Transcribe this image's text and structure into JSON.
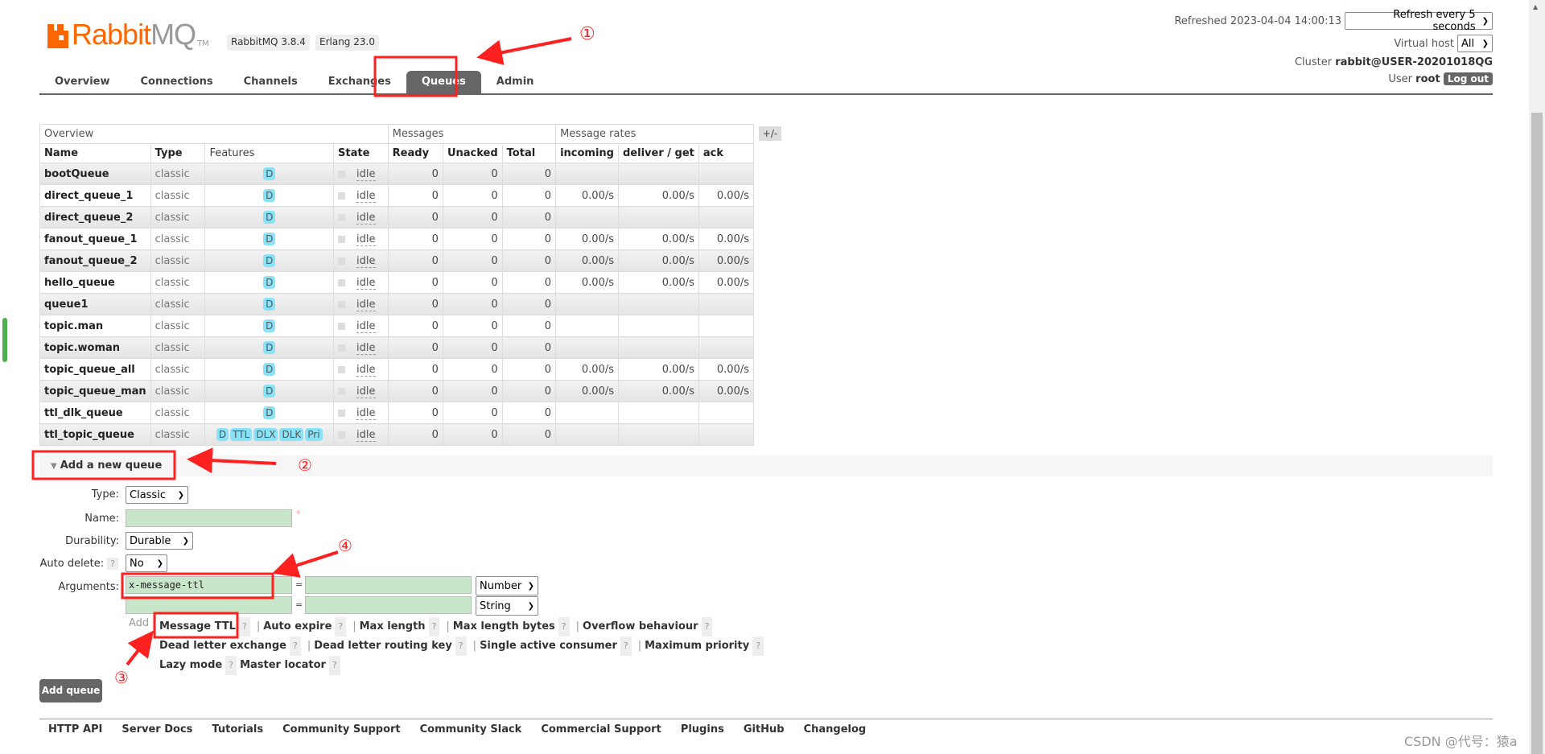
{
  "header": {
    "logo": "RabbitMQ",
    "logo_tm": "TM",
    "version": "RabbitMQ 3.8.4",
    "erlang": "Erlang 23.0",
    "refreshed": "Refreshed 2023-04-04 14:00:13",
    "refresh_select": "Refresh every 5 seconds",
    "vhost_label": "Virtual host",
    "vhost_select": "All",
    "cluster_label": "Cluster",
    "cluster": "rabbit@USER-20201018QG",
    "user_label": "User",
    "user": "root",
    "logout": "Log out"
  },
  "tabs": [
    {
      "label": "Overview"
    },
    {
      "label": "Connections"
    },
    {
      "label": "Channels"
    },
    {
      "label": "Exchanges"
    },
    {
      "label": "Queues",
      "active": true
    },
    {
      "label": "Admin"
    }
  ],
  "table": {
    "groups": [
      "Overview",
      "Messages",
      "Message rates"
    ],
    "toggle": "+/-",
    "columns": [
      "Name",
      "Type",
      "Features",
      "State",
      "Ready",
      "Unacked",
      "Total",
      "incoming",
      "deliver / get",
      "ack"
    ],
    "rows": [
      {
        "name": "bootQueue",
        "type": "classic",
        "features": [
          "D"
        ],
        "state": "idle",
        "ready": "0",
        "unacked": "0",
        "total": "0",
        "incoming": "",
        "deliver": "",
        "ack": ""
      },
      {
        "name": "direct_queue_1",
        "type": "classic",
        "features": [
          "D"
        ],
        "state": "idle",
        "ready": "0",
        "unacked": "0",
        "total": "0",
        "incoming": "0.00/s",
        "deliver": "0.00/s",
        "ack": "0.00/s"
      },
      {
        "name": "direct_queue_2",
        "type": "classic",
        "features": [
          "D"
        ],
        "state": "idle",
        "ready": "0",
        "unacked": "0",
        "total": "0",
        "incoming": "",
        "deliver": "",
        "ack": ""
      },
      {
        "name": "fanout_queue_1",
        "type": "classic",
        "features": [
          "D"
        ],
        "state": "idle",
        "ready": "0",
        "unacked": "0",
        "total": "0",
        "incoming": "0.00/s",
        "deliver": "0.00/s",
        "ack": "0.00/s"
      },
      {
        "name": "fanout_queue_2",
        "type": "classic",
        "features": [
          "D"
        ],
        "state": "idle",
        "ready": "0",
        "unacked": "0",
        "total": "0",
        "incoming": "0.00/s",
        "deliver": "0.00/s",
        "ack": "0.00/s"
      },
      {
        "name": "hello_queue",
        "type": "classic",
        "features": [
          "D"
        ],
        "state": "idle",
        "ready": "0",
        "unacked": "0",
        "total": "0",
        "incoming": "0.00/s",
        "deliver": "0.00/s",
        "ack": "0.00/s"
      },
      {
        "name": "queue1",
        "type": "classic",
        "features": [
          "D"
        ],
        "state": "idle",
        "ready": "0",
        "unacked": "0",
        "total": "0",
        "incoming": "",
        "deliver": "",
        "ack": ""
      },
      {
        "name": "topic.man",
        "type": "classic",
        "features": [
          "D"
        ],
        "state": "idle",
        "ready": "0",
        "unacked": "0",
        "total": "0",
        "incoming": "",
        "deliver": "",
        "ack": ""
      },
      {
        "name": "topic.woman",
        "type": "classic",
        "features": [
          "D"
        ],
        "state": "idle",
        "ready": "0",
        "unacked": "0",
        "total": "0",
        "incoming": "",
        "deliver": "",
        "ack": ""
      },
      {
        "name": "topic_queue_all",
        "type": "classic",
        "features": [
          "D"
        ],
        "state": "idle",
        "ready": "0",
        "unacked": "0",
        "total": "0",
        "incoming": "0.00/s",
        "deliver": "0.00/s",
        "ack": "0.00/s"
      },
      {
        "name": "topic_queue_man",
        "type": "classic",
        "features": [
          "D"
        ],
        "state": "idle",
        "ready": "0",
        "unacked": "0",
        "total": "0",
        "incoming": "0.00/s",
        "deliver": "0.00/s",
        "ack": "0.00/s"
      },
      {
        "name": "ttl_dlk_queue",
        "type": "classic",
        "features": [
          "D"
        ],
        "state": "idle",
        "ready": "0",
        "unacked": "0",
        "total": "0",
        "incoming": "",
        "deliver": "",
        "ack": ""
      },
      {
        "name": "ttl_topic_queue",
        "type": "classic",
        "features": [
          "D",
          "TTL",
          "DLX",
          "DLK",
          "Pri"
        ],
        "state": "idle",
        "ready": "0",
        "unacked": "0",
        "total": "0",
        "incoming": "",
        "deliver": "",
        "ack": ""
      }
    ]
  },
  "add_queue": {
    "title": "Add a new queue",
    "type_label": "Type:",
    "type_value": "Classic",
    "name_label": "Name:",
    "name_value": "",
    "required": "*",
    "durability_label": "Durability:",
    "durability_value": "Durable",
    "autodelete_label": "Auto delete:",
    "autodelete_value": "No",
    "help": "?",
    "arguments_label": "Arguments:",
    "arg1_key": "x-message-ttl",
    "arg1_value": "",
    "arg1_type": "Number",
    "arg2_key": "",
    "arg2_value": "",
    "arg2_type": "String",
    "equals": "=",
    "add_label": "Add",
    "links": [
      "Message TTL",
      "Auto expire",
      "Max length",
      "Max length bytes",
      "Overflow behaviour",
      "Dead letter exchange",
      "Dead letter routing key",
      "Single active consumer",
      "Maximum priority",
      "Lazy mode",
      "Master locator"
    ],
    "submit": "Add queue"
  },
  "footer": [
    "HTTP API",
    "Server Docs",
    "Tutorials",
    "Community Support",
    "Community Slack",
    "Commercial Support",
    "Plugins",
    "GitHub",
    "Changelog"
  ],
  "annotations": {
    "n1": "①",
    "n2": "②",
    "n3": "③",
    "n4": "④",
    "color": "#ff2020"
  },
  "watermark": "CSDN @代号：猿a"
}
